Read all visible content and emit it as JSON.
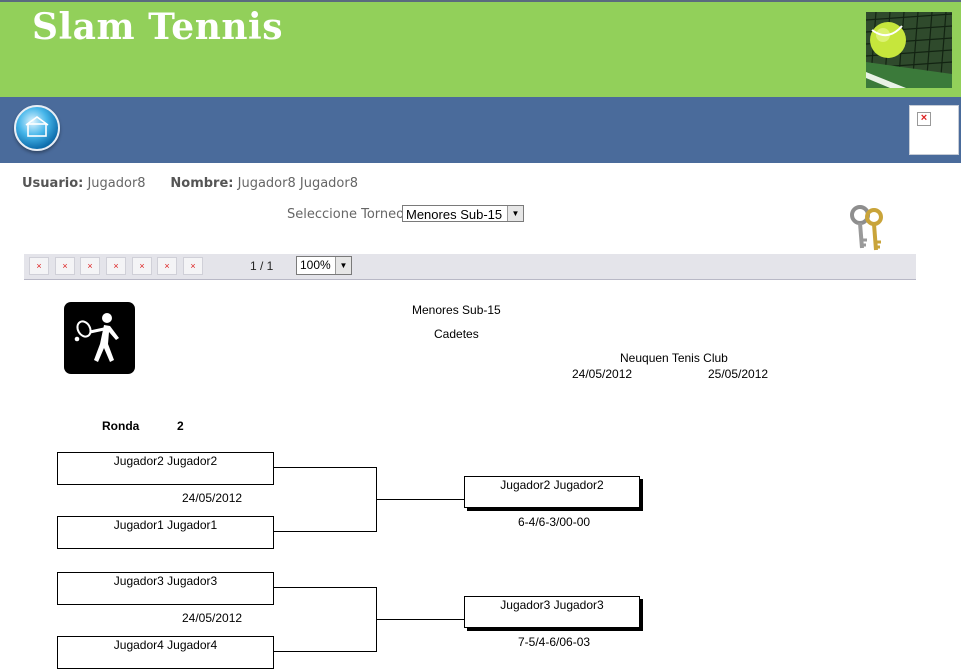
{
  "header": {
    "title": "Slam Tennis",
    "image_icon": "tennis-ball-net-photo"
  },
  "nav": {
    "home_icon": "home-icon",
    "broken_icon": "broken-image-icon"
  },
  "user": {
    "usuario_label": "Usuario:",
    "usuario_value": "Jugador8",
    "nombre_label": "Nombre:",
    "nombre_value": "Jugador8 Jugador8"
  },
  "torneo": {
    "label": "Seleccione Torneo:",
    "selected": "Menores Sub-15"
  },
  "toolbar": {
    "buttons": [
      "broken-image-icon",
      "broken-image-icon",
      "broken-image-icon",
      "broken-image-icon",
      "broken-image-icon",
      "broken-image-icon",
      "broken-image-icon"
    ],
    "page_indicator": "1 / 1",
    "zoom": "100%"
  },
  "report": {
    "tournament": "Menores Sub-15",
    "category": "Cadetes",
    "club": "Neuquen Tenis Club",
    "start_date": "24/05/2012",
    "end_date": "25/05/2012",
    "round_label": "Ronda",
    "round_value": "2",
    "matches": [
      {
        "player1": "Jugador2 Jugador2",
        "player2": "Jugador1 Jugador1",
        "date": "24/05/2012",
        "winner": "Jugador2 Jugador2",
        "score": "6-4/6-3/00-00"
      },
      {
        "player1": "Jugador3 Jugador3",
        "player2": "Jugador4 Jugador4",
        "date": "24/05/2012",
        "winner": "Jugador3 Jugador3",
        "score": "7-5/4-6/06-03"
      }
    ]
  }
}
